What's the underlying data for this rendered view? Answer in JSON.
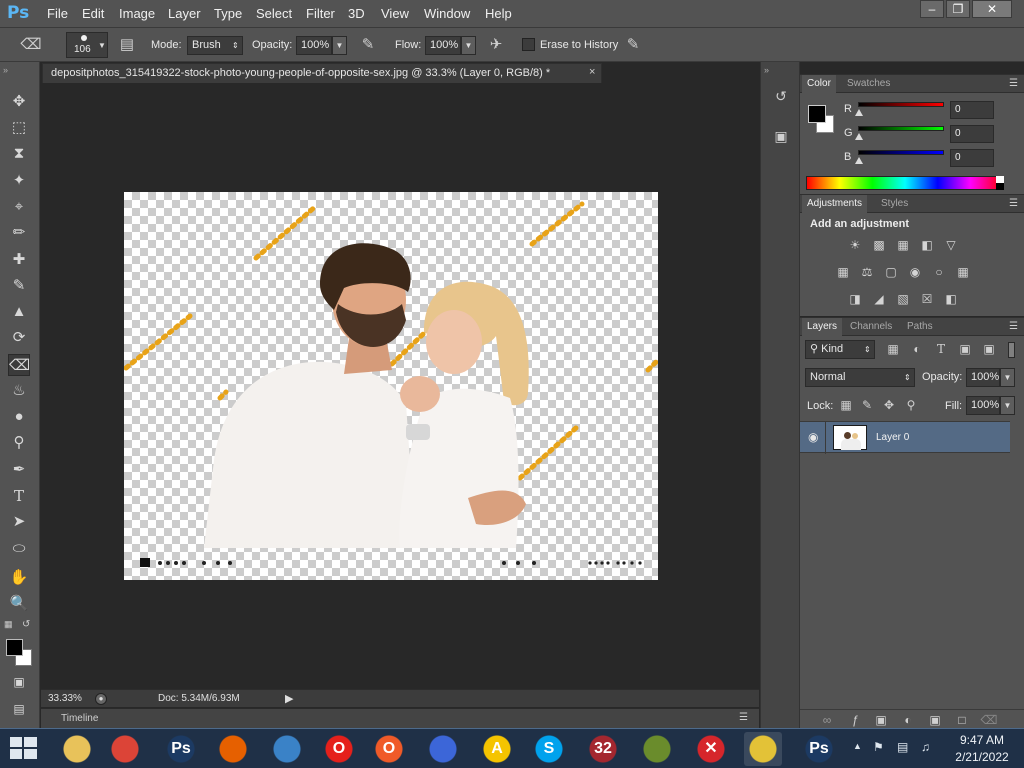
{
  "app": {
    "logo": "Ps",
    "menu": [
      "File",
      "Edit",
      "Image",
      "Layer",
      "Type",
      "Select",
      "Filter",
      "3D",
      "View",
      "Window",
      "Help"
    ],
    "window_buttons": [
      "minimize-icon",
      "restore-icon",
      "close-icon"
    ]
  },
  "options_bar": {
    "tool_icon": "eraser-icon",
    "brush_size": "106",
    "mode_label": "Mode:",
    "mode_value": "Brush",
    "opacity_label": "Opacity:",
    "opacity_value": "100%",
    "flow_label": "Flow:",
    "flow_value": "100%",
    "erase_history_label": "Erase to History",
    "erase_history_checked": false
  },
  "tools": [
    "move-tool-icon",
    "marquee-tool-icon",
    "lasso-tool-icon",
    "quick-select-tool-icon",
    "crop-tool-icon",
    "eyedropper-tool-icon",
    "healing-brush-icon",
    "brush-tool-icon",
    "clone-stamp-icon",
    "history-brush-icon",
    "eraser-tool-icon",
    "paint-bucket-icon",
    "blur-tool-icon",
    "dodge-tool-icon",
    "pen-tool-icon",
    "type-tool-icon",
    "path-select-icon",
    "ellipse-tool-icon",
    "hand-tool-icon",
    "zoom-tool-icon"
  ],
  "document": {
    "tab_title": "depositphotos_315419322-stock-photo-young-people-of-opposite-sex.jpg @ 33.3% (Layer 0, RGB/8) *",
    "close_glyph": "×"
  },
  "status": {
    "zoom": "33.33%",
    "doc_size": "Doc: 5.34M/6.93M",
    "timeline_label": "Timeline"
  },
  "color_panel": {
    "tabs": [
      "Color",
      "Swatches"
    ],
    "foreground": "#000000",
    "background": "#ffffff",
    "channels": [
      {
        "label": "R",
        "value": "0",
        "gradient": "#ff0000"
      },
      {
        "label": "G",
        "value": "0",
        "gradient": "#00ff00"
      },
      {
        "label": "B",
        "value": "0",
        "gradient": "#0000ff"
      }
    ]
  },
  "adjustments_panel": {
    "tabs": [
      "Adjustments",
      "Styles"
    ],
    "heading": "Add an adjustment",
    "row1": [
      "brightness-contrast-icon",
      "levels-icon",
      "curves-icon",
      "exposure-icon",
      "vibrance-icon"
    ],
    "row2": [
      "hue-saturation-icon",
      "color-balance-icon",
      "black-white-icon",
      "photo-filter-icon",
      "channel-mixer-icon",
      "color-lookup-icon"
    ],
    "row3": [
      "invert-icon",
      "posterize-icon",
      "threshold-icon",
      "selective-color-icon",
      "gradient-map-icon"
    ]
  },
  "layers_panel": {
    "tabs": [
      "Layers",
      "Channels",
      "Paths"
    ],
    "filter_kind": "Kind",
    "blend_mode": "Normal",
    "opacity_label": "Opacity:",
    "opacity_value": "100%",
    "lock_label": "Lock:",
    "fill_label": "Fill:",
    "fill_value": "100%",
    "layers": [
      {
        "name": "Layer 0",
        "visible": true,
        "selected": true
      }
    ],
    "footer_icons": [
      "link-icon",
      "fx-icon",
      "mask-icon",
      "adjustment-layer-icon",
      "group-folder-icon",
      "new-layer-icon",
      "trash-icon"
    ]
  },
  "taskbar": {
    "apps": [
      {
        "name": "file-explorer-icon",
        "color": "#e8c25a"
      },
      {
        "name": "chrome-icon",
        "color": "#dc4437"
      },
      {
        "name": "photoshop-taskbar-icon",
        "color": "#1c3a63",
        "glyph": "Ps"
      },
      {
        "name": "firefox-icon",
        "color": "#e66000"
      },
      {
        "name": "thunderbird-icon",
        "color": "#3a82c7"
      },
      {
        "name": "opera-icon",
        "color": "#e5201b",
        "glyph": "O"
      },
      {
        "name": "opera-gx-icon",
        "color": "#f05a28",
        "glyph": "O"
      },
      {
        "name": "shark-app-icon",
        "color": "#3c66d8"
      },
      {
        "name": "archicad-icon",
        "color": "#f5c400",
        "glyph": "A"
      },
      {
        "name": "skype-icon",
        "color": "#00a2ed",
        "glyph": "S"
      },
      {
        "name": "puzzle-app-icon",
        "color": "#a4272f",
        "glyph": "32"
      },
      {
        "name": "winrar-icon",
        "color": "#6a8c2c"
      },
      {
        "name": "error-app-icon",
        "color": "#d6262b",
        "glyph": "✕"
      },
      {
        "name": "security-shield-icon",
        "color": "#e3c237"
      },
      {
        "name": "photoshop-active-icon",
        "color": "#1c3a63",
        "glyph": "Ps"
      }
    ],
    "time": "9:47 AM",
    "date": "2/21/2022"
  }
}
